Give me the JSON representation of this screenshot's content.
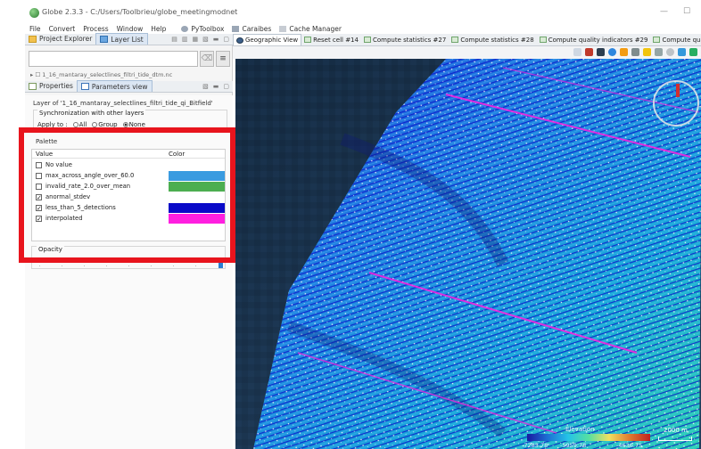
{
  "window": {
    "title": "Globe 2.3.3 - C:/Users/Toolbrieu/globe_meetingmodnet",
    "minimize_glyph": "—",
    "maximize_glyph": "☐"
  },
  "menubar": {
    "items": [
      "File",
      "Convert",
      "Process",
      "Window",
      "Help"
    ],
    "pytoolbox": "PyToolbox",
    "caraibes": "Caraibes",
    "cache_manager": "Cache Manager"
  },
  "left_tabs": {
    "project_explorer": "Project Explorer",
    "layer_list": "Layer List",
    "properties": "Properties",
    "parameters_view": "Parameters view"
  },
  "layer_list": {
    "search_value": "",
    "layer_entry": "▸ ☐ 1_16_mantaray_selectlines_filtri_tide_dtm.nc"
  },
  "parameters": {
    "layer_of": "Layer of '1_16_mantaray_selectlines_filtri_tide_qi_Bitfield'",
    "sync_title": "Synchronization with other layers",
    "apply_to": "Apply to :",
    "radio_all": "All",
    "radio_group": "Group",
    "radio_none": "None",
    "palette_title": "Palette",
    "col_value": "Value",
    "col_color": "Color",
    "rows": [
      {
        "label": "No value",
        "checked": false,
        "check_glyph": "",
        "color": ""
      },
      {
        "label": "max_across_angle_over_60.0",
        "checked": false,
        "check_glyph": "",
        "color": "#3a9be0"
      },
      {
        "label": "invalid_rate_2.0_over_mean",
        "checked": false,
        "check_glyph": "",
        "color": "#4cae50"
      },
      {
        "label": "anormal_stdev",
        "checked": true,
        "check_glyph": "✓",
        "color": ""
      },
      {
        "label": "less_than_5_detections",
        "checked": true,
        "check_glyph": "✓",
        "color": "#0a0ac8"
      },
      {
        "label": "interpolated",
        "checked": true,
        "check_glyph": "✓",
        "color": "#ff1fe0"
      }
    ],
    "opacity_label": "Opacity",
    "opacity_level": 1.0
  },
  "right_tabs": [
    "Geographic View",
    "Reset cell #14",
    "Compute statistics #27",
    "Compute statistics #28",
    "Compute quality indicators #29",
    "Compute quality indicators #32"
  ],
  "map": {
    "legend_title": "Elevation",
    "legend_min": "-7283.78",
    "legend_mid": "-5959.78",
    "legend_max": "-4636.75",
    "scale_label": "2000 m",
    "colors": {
      "deep_blue": "#0a0ac8",
      "cyan": "#25c3e8",
      "magenta": "#ff1fe0",
      "highlight_red": "#e8141d"
    }
  }
}
